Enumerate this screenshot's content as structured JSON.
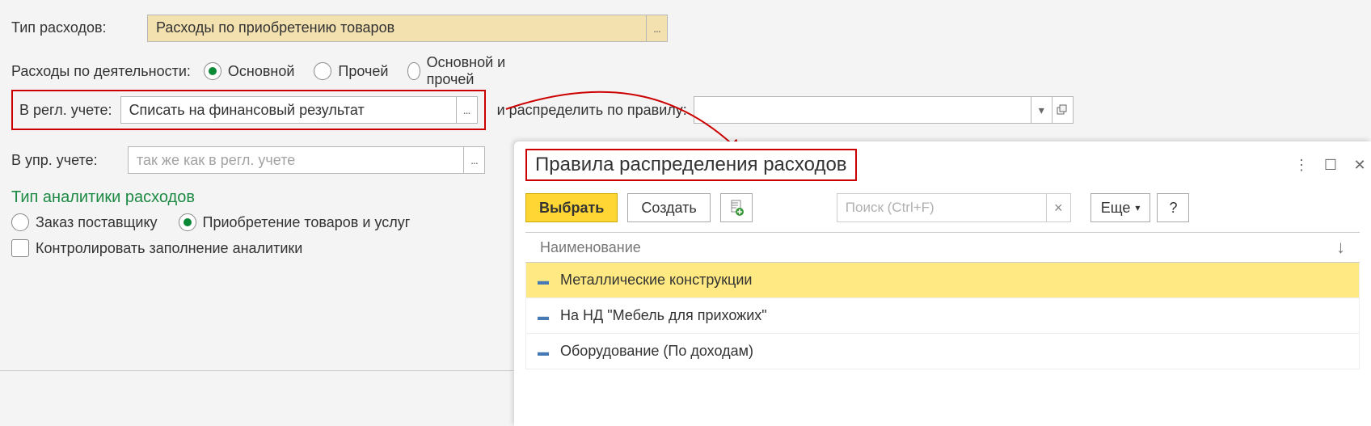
{
  "expenseType": {
    "label": "Тип расходов:",
    "value": "Расходы по приобретению товаров"
  },
  "activity": {
    "label": "Расходы по деятельности:",
    "options": [
      "Основной",
      "Прочей",
      "Основной и прочей"
    ],
    "selected": 0
  },
  "reglAccount": {
    "label": "В регл. учете:",
    "value": "Списать на финансовый результат"
  },
  "distributeRule": {
    "label": "и распределить по правилу:",
    "value": ""
  },
  "mgmtAccount": {
    "label": "В упр. учете:",
    "placeholder": "так же как в регл. учете"
  },
  "analytics": {
    "heading": "Тип аналитики расходов",
    "options": [
      "Заказ поставщику",
      "Приобретение товаров и услуг"
    ],
    "selected": 1,
    "controlLabel": "Контролировать заполнение аналитики"
  },
  "popup": {
    "title": "Правила распределения расходов",
    "select": "Выбрать",
    "create": "Создать",
    "more": "Еще",
    "help": "?",
    "searchPlaceholder": "Поиск (Ctrl+F)",
    "listHeader": "Наименование",
    "items": [
      "Металлические конструкции",
      "На НД \"Мебель для прихожих\"",
      "Оборудование (По доходам)"
    ],
    "selectedItem": 0
  }
}
